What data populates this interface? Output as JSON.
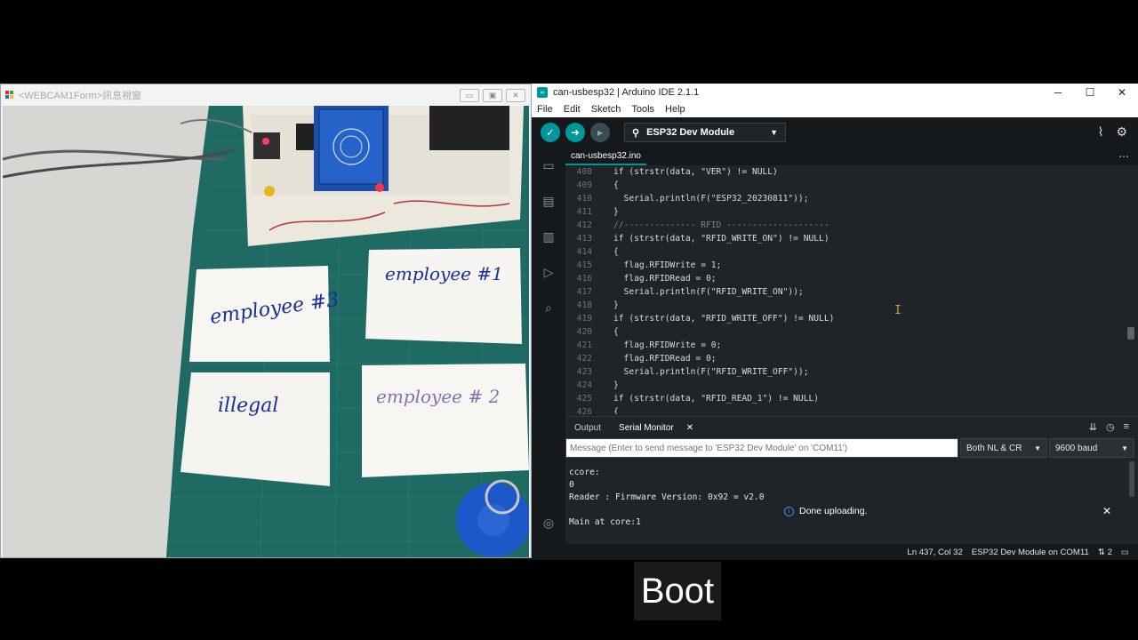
{
  "webcam": {
    "title": "<WEBCAM1Form>訊息視窗"
  },
  "cards": [
    {
      "text": "employee #3"
    },
    {
      "text": "employee #1"
    },
    {
      "text": "illegal"
    },
    {
      "text": "employee # 2"
    }
  ],
  "ide": {
    "title": "can-usbesp32 | Arduino IDE 2.1.1",
    "menu": [
      "File",
      "Edit",
      "Sketch",
      "Tools",
      "Help"
    ],
    "board": "ESP32 Dev Module",
    "file_tab": "can-usbesp32.ino",
    "code_lines": [
      {
        "n": "408",
        "code": "if (strstr(data, \"VER\") != NULL)"
      },
      {
        "n": "409",
        "code": "{"
      },
      {
        "n": "410",
        "code": "  Serial.println(F(\"ESP32_20230811\"));"
      },
      {
        "n": "411",
        "code": "}"
      },
      {
        "n": "412",
        "code": "//-------------- RFID --------------------"
      },
      {
        "n": "413",
        "code": "if (strstr(data, \"RFID_WRITE_ON\") != NULL)"
      },
      {
        "n": "414",
        "code": "{"
      },
      {
        "n": "415",
        "code": "  flag.RFIDWrite = 1;"
      },
      {
        "n": "416",
        "code": "  flag.RFIDRead = 0;"
      },
      {
        "n": "417",
        "code": "  Serial.println(F(\"RFID_WRITE_ON\"));"
      },
      {
        "n": "418",
        "code": "}"
      },
      {
        "n": "419",
        "code": "if (strstr(data, \"RFID_WRITE_OFF\") != NULL)"
      },
      {
        "n": "420",
        "code": "{"
      },
      {
        "n": "421",
        "code": "  flag.RFIDWrite = 0;"
      },
      {
        "n": "422",
        "code": "  flag.RFIDRead = 0;"
      },
      {
        "n": "423",
        "code": "  Serial.println(F(\"RFID_WRITE_OFF\"));"
      },
      {
        "n": "424",
        "code": "}"
      },
      {
        "n": "425",
        "code": "if (strstr(data, \"RFID_READ_1\") != NULL)"
      },
      {
        "n": "426",
        "code": "{"
      }
    ],
    "panel_tabs": {
      "output": "Output",
      "serial": "Serial Monitor"
    },
    "serial": {
      "placeholder": "Message (Enter to send message to 'ESP32 Dev Module' on 'COM11')",
      "line_ending": "Both NL & CR",
      "baud": "9600 baud",
      "lines": [
        "ccore:",
        "0",
        "Reader : Firmware Version: 0x92 = v2.0",
        "",
        "Main at core:1"
      ]
    },
    "toast": "Done uploading.",
    "status": {
      "position": "Ln 437, Col 32",
      "board_port": "ESP32 Dev Module on COM11",
      "notifications": "2"
    }
  },
  "caption": "Boot"
}
